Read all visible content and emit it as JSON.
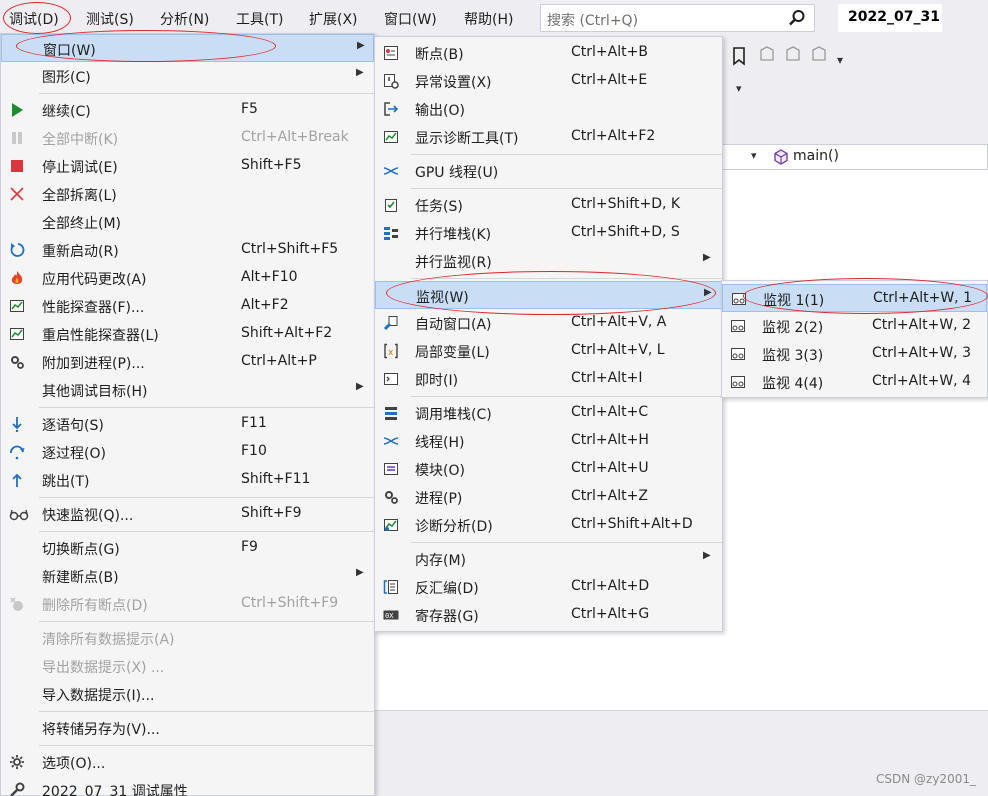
{
  "menubar": {
    "items": [
      "调试(D)",
      "测试(S)",
      "分析(N)",
      "工具(T)",
      "扩展(X)",
      "窗口(W)",
      "帮助(H)"
    ],
    "search_placeholder": "搜索 (Ctrl+Q)",
    "date": "2022_07_31"
  },
  "editor": {
    "nav_function": "main()"
  },
  "watermark": "CSDN @zy2001_",
  "debug_menu": {
    "items": [
      {
        "label": "窗口(W)",
        "shortcut": "",
        "icon": "none",
        "submenu": true,
        "selected": true
      },
      {
        "label": "图形(C)",
        "shortcut": "",
        "icon": "none",
        "submenu": true
      },
      {
        "label": "继续(C)",
        "shortcut": "F5",
        "icon": "play-icon"
      },
      {
        "label": "全部中断(K)",
        "shortcut": "Ctrl+Alt+Break",
        "icon": "pause-icon",
        "disabled": true
      },
      {
        "label": "停止调试(E)",
        "shortcut": "Shift+F5",
        "icon": "stop-icon"
      },
      {
        "label": "全部拆离(L)",
        "shortcut": "",
        "icon": "detach-icon"
      },
      {
        "label": "全部终止(M)",
        "shortcut": "",
        "icon": "none"
      },
      {
        "label": "重新启动(R)",
        "shortcut": "Ctrl+Shift+F5",
        "icon": "restart-icon"
      },
      {
        "label": "应用代码更改(A)",
        "shortcut": "Alt+F10",
        "icon": "hot-reload-icon"
      },
      {
        "label": "性能探查器(F)...",
        "shortcut": "Alt+F2",
        "icon": "profiler-icon"
      },
      {
        "label": "重启性能探查器(L)",
        "shortcut": "Shift+Alt+F2",
        "icon": "profiler-restart-icon"
      },
      {
        "label": "附加到进程(P)...",
        "shortcut": "Ctrl+Alt+P",
        "icon": "attach-gear-icon"
      },
      {
        "label": "其他调试目标(H)",
        "shortcut": "",
        "icon": "none",
        "submenu": true
      },
      {
        "label": "逐语句(S)",
        "shortcut": "F11",
        "icon": "step-into-icon"
      },
      {
        "label": "逐过程(O)",
        "shortcut": "F10",
        "icon": "step-over-icon"
      },
      {
        "label": "跳出(T)",
        "shortcut": "Shift+F11",
        "icon": "step-out-icon"
      },
      {
        "label": "快速监视(Q)...",
        "shortcut": "Shift+F9",
        "icon": "glasses-icon"
      },
      {
        "label": "切换断点(G)",
        "shortcut": "F9",
        "icon": "none"
      },
      {
        "label": "新建断点(B)",
        "shortcut": "",
        "icon": "none",
        "submenu": true
      },
      {
        "label": "删除所有断点(D)",
        "shortcut": "Ctrl+Shift+F9",
        "icon": "delete-breakpoints-icon",
        "disabled": true
      },
      {
        "label": "清除所有数据提示(A)",
        "shortcut": "",
        "icon": "none",
        "disabled": true
      },
      {
        "label": "导出数据提示(X) ...",
        "shortcut": "",
        "icon": "none",
        "disabled": true
      },
      {
        "label": "导入数据提示(I)...",
        "shortcut": "",
        "icon": "none"
      },
      {
        "label": "将转储另存为(V)...",
        "shortcut": "",
        "icon": "none"
      },
      {
        "label": "选项(O)...",
        "shortcut": "",
        "icon": "gear-icon"
      },
      {
        "label": "2022_07_31 调试属性",
        "shortcut": "",
        "icon": "wrench-icon"
      }
    ]
  },
  "window_menu": {
    "items": [
      {
        "label": "断点(B)",
        "shortcut": "Ctrl+Alt+B",
        "icon": "breakpoints-window-icon"
      },
      {
        "label": "异常设置(X)",
        "shortcut": "Ctrl+Alt+E",
        "icon": "exception-settings-icon"
      },
      {
        "label": "输出(O)",
        "shortcut": "",
        "icon": "output-icon"
      },
      {
        "label": "显示诊断工具(T)",
        "shortcut": "Ctrl+Alt+F2",
        "icon": "diagnostics-icon"
      },
      {
        "label": "GPU 线程(U)",
        "shortcut": "",
        "icon": "gpu-threads-icon"
      },
      {
        "label": "任务(S)",
        "shortcut": "Ctrl+Shift+D, K",
        "icon": "tasks-icon"
      },
      {
        "label": "并行堆栈(K)",
        "shortcut": "Ctrl+Shift+D, S",
        "icon": "parallel-stacks-icon"
      },
      {
        "label": "并行监视(R)",
        "shortcut": "",
        "icon": "none",
        "submenu": true
      },
      {
        "label": "监视(W)",
        "shortcut": "",
        "icon": "none",
        "submenu": true,
        "selected": true
      },
      {
        "label": "自动窗口(A)",
        "shortcut": "Ctrl+Alt+V, A",
        "icon": "autos-icon"
      },
      {
        "label": "局部变量(L)",
        "shortcut": "Ctrl+Alt+V, L",
        "icon": "locals-icon"
      },
      {
        "label": "即时(I)",
        "shortcut": "Ctrl+Alt+I",
        "icon": "immediate-icon"
      },
      {
        "label": "调用堆栈(C)",
        "shortcut": "Ctrl+Alt+C",
        "icon": "call-stack-icon"
      },
      {
        "label": "线程(H)",
        "shortcut": "Ctrl+Alt+H",
        "icon": "threads-icon"
      },
      {
        "label": "模块(O)",
        "shortcut": "Ctrl+Alt+U",
        "icon": "modules-icon"
      },
      {
        "label": "进程(P)",
        "shortcut": "Ctrl+Alt+Z",
        "icon": "processes-icon"
      },
      {
        "label": "诊断分析(D)",
        "shortcut": "Ctrl+Shift+Alt+D",
        "icon": "diagnostic-analysis-icon"
      },
      {
        "label": "内存(M)",
        "shortcut": "",
        "icon": "none",
        "submenu": true
      },
      {
        "label": "反汇编(D)",
        "shortcut": "Ctrl+Alt+D",
        "icon": "disassembly-icon"
      },
      {
        "label": "寄存器(G)",
        "shortcut": "Ctrl+Alt+G",
        "icon": "registers-icon"
      }
    ]
  },
  "watch_menu": {
    "items": [
      {
        "label": "监视 1(1)",
        "shortcut": "Ctrl+Alt+W, 1",
        "icon": "watch-icon",
        "selected": true
      },
      {
        "label": "监视 2(2)",
        "shortcut": "Ctrl+Alt+W, 2",
        "icon": "watch-icon"
      },
      {
        "label": "监视 3(3)",
        "shortcut": "Ctrl+Alt+W, 3",
        "icon": "watch-icon"
      },
      {
        "label": "监视 4(4)",
        "shortcut": "Ctrl+Alt+W, 4",
        "icon": "watch-icon"
      }
    ]
  }
}
